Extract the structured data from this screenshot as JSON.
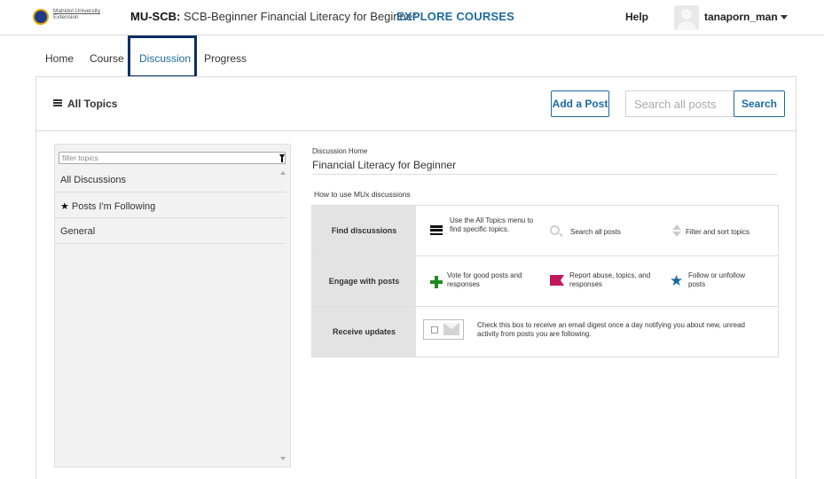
{
  "header": {
    "logo_line1": "Mahidol University",
    "logo_line2": "Extension",
    "course_code": "MU-SCB:",
    "course_name": "SCB-Beginner Financial Literacy for Beginner",
    "explore": "EXPLORE COURSES",
    "help": "Help",
    "username": "tanaporn_man"
  },
  "tabs": [
    {
      "label": "Home"
    },
    {
      "label": "Course"
    },
    {
      "label": "Discussion",
      "active": true
    },
    {
      "label": "Progress"
    }
  ],
  "discussion": {
    "all_topics": "All Topics",
    "add_post": "Add a Post",
    "search_placeholder": "Search all posts",
    "search_button": "Search"
  },
  "sidebar": {
    "filter_placeholder": "filter topics",
    "topics": [
      {
        "label": "All Discussions"
      },
      {
        "label": "Posts I'm Following",
        "icon": "star-icon"
      },
      {
        "label": "General"
      }
    ]
  },
  "main": {
    "breadcrumb": "Discussion Home",
    "title": "Financial Literacy for Beginner",
    "howto": "How to use MUx discussions",
    "rows": [
      {
        "label": "Find discussions",
        "items": [
          {
            "icon": "menu-icon",
            "text": "Use the All Topics menu to find specific topics."
          },
          {
            "icon": "search-icon",
            "text": "Search all posts"
          },
          {
            "icon": "sort-icon",
            "text": "Filter and sort topics"
          }
        ]
      },
      {
        "label": "Engage with posts",
        "items": [
          {
            "icon": "plus-icon",
            "text": "Vote for good posts and responses"
          },
          {
            "icon": "flag-icon",
            "text": "Report abuse, topics, and responses"
          },
          {
            "icon": "star-icon",
            "text": "Follow or unfollow posts"
          }
        ]
      },
      {
        "label": "Receive updates",
        "items": [
          {
            "icon": "mail-icon",
            "text": "Check this box to receive an email digest once a day notifying you about new, unread activity from posts you are following."
          }
        ]
      }
    ]
  },
  "colors": {
    "accent": "#1b6aa1",
    "highlight_border": "#0b2f64",
    "vote_green": "#1f8a1f",
    "report_pink": "#c2185b"
  }
}
